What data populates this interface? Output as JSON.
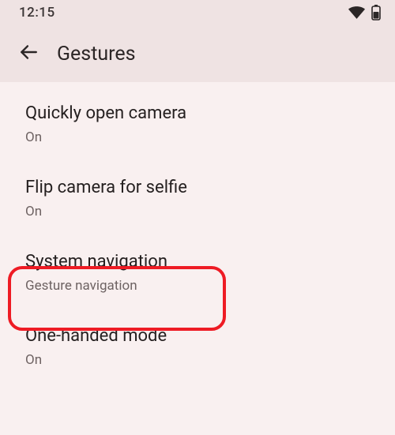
{
  "status": {
    "time": "12:15"
  },
  "header": {
    "title": "Gestures"
  },
  "items": [
    {
      "title": "Quickly open camera",
      "subtitle": "On"
    },
    {
      "title": "Flip camera for selfie",
      "subtitle": "On"
    },
    {
      "title": "System navigation",
      "subtitle": "Gesture navigation"
    },
    {
      "title": "One-handed mode",
      "subtitle": "On"
    }
  ]
}
